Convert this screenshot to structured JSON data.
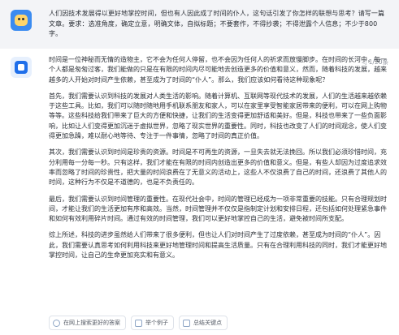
{
  "user": {
    "question": "人们因技术发展得以更好地掌控时间，但也有人因此成了时间的仆人，这句话引发了你怎样的联想与思考？请写一篇文章。要求：选准角度，确定立意，明确文体，自拟标题；不要套作，不得抄袭；不得泄露个人信息；不少于800字。"
  },
  "answer": {
    "page_counter": "1/20条",
    "paragraphs": [
      "时间是一位神秘而无情的造物主，它不会为任何人停留，也不会因为任何人的祈求而放慢脚步。在时间的长河中，每一个人都是匆匆过客，我们能做的只是在有限的时间内尽可能地去创造更多的价值和意义，然而，随着科技的发展，越来越多的人开始对时间产生依赖，甚至成为了时间的“仆人”。那么，我们应该如何看待这种现象呢？",
      "首先，我们需要认识到科技的发展对人类生活的影响。随着计算机、互联网等现代技术的发展，人们的生活越来越依赖于这些工具。比如，我们可以随时随地用手机联系朋友和家人，可以在家里享受智能家居带来的便利，可以在网上购物等等。这些科技给我们带来了巨大的方便和快捷，让我们的生活变得更加舒适和美好。但是，科技也带来了一些负面影响，比如让人们变得更加沉迷于虚拟世界，忽略了现实世界的重要性。同时，科技也改变了人们的时间观念，使人们变得更加急躁，难以耐心地等待、专注于一件事情，忽略了时间的真正价值。",
      "其次，我们需要认识到时间是珍贵的资源。时间是不可再生的资源，一旦失去就无法挽回。所以我们必须珍惜时间，充分利用每一分每一秒。只有这样，我们才能在有限的时间内创造出更多的价值和意义。但是，有些人却因为过度追求效率而忽略了时间的珍贵性，把大量的时间浪费在了无意义的活动上，这些人不仅浪费了自己的时间，还浪费了其他人的时间，这种行为不仅是不道德的，也是不负责任的。",
      "最后，我们需要认识到时间管理的重要性。在现代社会中，时间的管理已经成为一项非常重要的技能。只有合理规划时间，才能让我们的生活更加有序和高效。当然，时间管理并不仅仅是指制定计划和安排日程，还包括如何处理紧急事件和如何有效利用碎片时间。通过有效的时间管理，我们可以更好地掌控自己的生活，避免被时间所支配。",
      "综上所述，科技的进步虽然给人们带来了很多便利，但也让人们对时间产生了过度依赖，甚至成为时间的“仆人”。因此，我们需要认真思考如何利用科技来更好地管理时间和提高生活质量。只有在合理利用科技的同时，我们才能更好地掌控时间，让自己的生命更加充实和有意义。"
    ]
  },
  "actions": {
    "search_web": "在网上搜索更好的答案",
    "example": "举个例子",
    "summary": "总结关键点"
  }
}
